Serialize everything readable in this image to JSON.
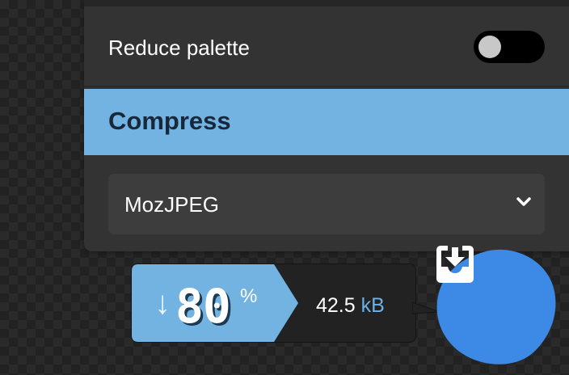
{
  "options": {
    "reduce_palette_label": "Reduce palette",
    "reduce_palette_enabled": false
  },
  "compress": {
    "section_title": "Compress",
    "selected_codec": "MozJPEG"
  },
  "results": {
    "reduction_arrow": "↓",
    "reduction_percent": "80",
    "percent_sign": "%",
    "size_number": "42.5",
    "size_unit": "kB"
  },
  "icons": {
    "codec_dropdown": "chevron-down-icon",
    "download": "download-tray-icon",
    "reduction": "arrow-down-icon"
  },
  "colors": {
    "accent_blue": "#72b3e2",
    "download_blue": "#3d8ae6",
    "panel_bg": "#333333",
    "unit_blue": "#6bb0e8"
  }
}
